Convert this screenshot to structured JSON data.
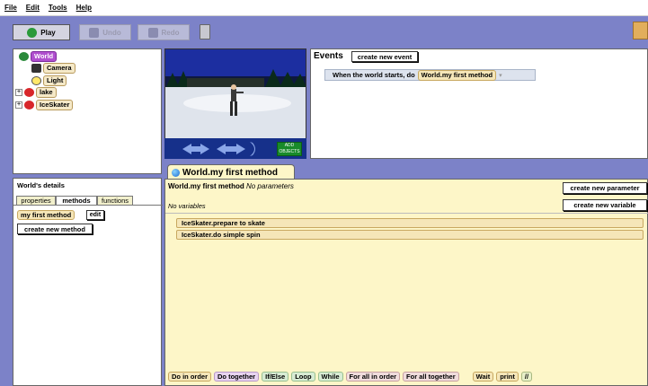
{
  "menu": [
    "File",
    "Edit",
    "Tools",
    "Help"
  ],
  "toolbar": {
    "play_label": "Play",
    "undo_label": "Undo",
    "redo_label": "Redo"
  },
  "tree": {
    "world": "World",
    "camera": "Camera",
    "light": "Light",
    "lake": "lake",
    "iceskater": "IceSkater",
    "expand": "+"
  },
  "scene": {
    "add_objects": "ADD OBJECTS"
  },
  "events": {
    "title": "Events",
    "create_button": "create new event",
    "trigger": "When the world starts, do",
    "method": "World.my first method"
  },
  "details": {
    "title": "World's details",
    "tabs": [
      "properties",
      "methods",
      "functions"
    ],
    "method_name": "my first method",
    "edit_button": "edit",
    "create_method_button": "create new method"
  },
  "editor": {
    "tab_title": "World.my first method",
    "method_name": "World.my first method",
    "params": "No parameters",
    "vars": "No variables",
    "create_param": "create new parameter",
    "create_var": "create new variable",
    "statements": [
      "IceSkater.prepare to skate",
      "IceSkater.do simple spin"
    ],
    "controls": [
      "Do in order",
      "Do together",
      "If/Else",
      "Loop",
      "While",
      "For all in order",
      "For all together",
      "Wait",
      "print",
      "//"
    ]
  },
  "colors": {
    "background": "#7c82c8",
    "world_selected": "#b04fcf",
    "method_chip": "#f5e6b8",
    "editor_bg": "#fdf6c8"
  }
}
